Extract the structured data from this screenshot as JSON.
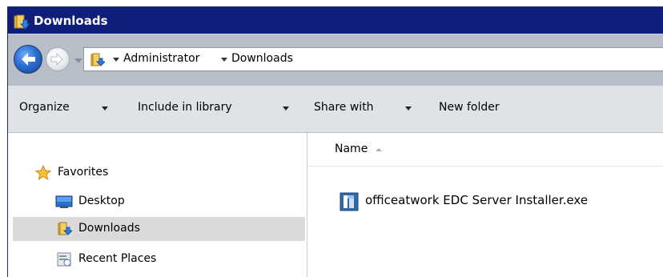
{
  "window": {
    "title": "Downloads"
  },
  "address": {
    "crumbs": [
      "Administrator",
      "Downloads"
    ]
  },
  "toolbar": {
    "organize": "Organize",
    "include_in_library": "Include in library",
    "share_with": "Share with",
    "new_folder": "New folder"
  },
  "sidebar": {
    "items": [
      {
        "label": "Favorites",
        "icon": "star-icon"
      },
      {
        "label": "Desktop",
        "icon": "desktop-icon"
      },
      {
        "label": "Downloads",
        "icon": "downloads-folder-icon",
        "selected": true
      },
      {
        "label": "Recent Places",
        "icon": "recent-places-icon"
      }
    ]
  },
  "content": {
    "column_header": "Name",
    "files": [
      {
        "name": "officeatwork EDC Server Installer.exe",
        "icon": "installer-icon"
      }
    ]
  },
  "colors": {
    "titlebar": "#0e1e79",
    "toolbar": "#dfe3e8",
    "selected_row": "#dadada"
  }
}
